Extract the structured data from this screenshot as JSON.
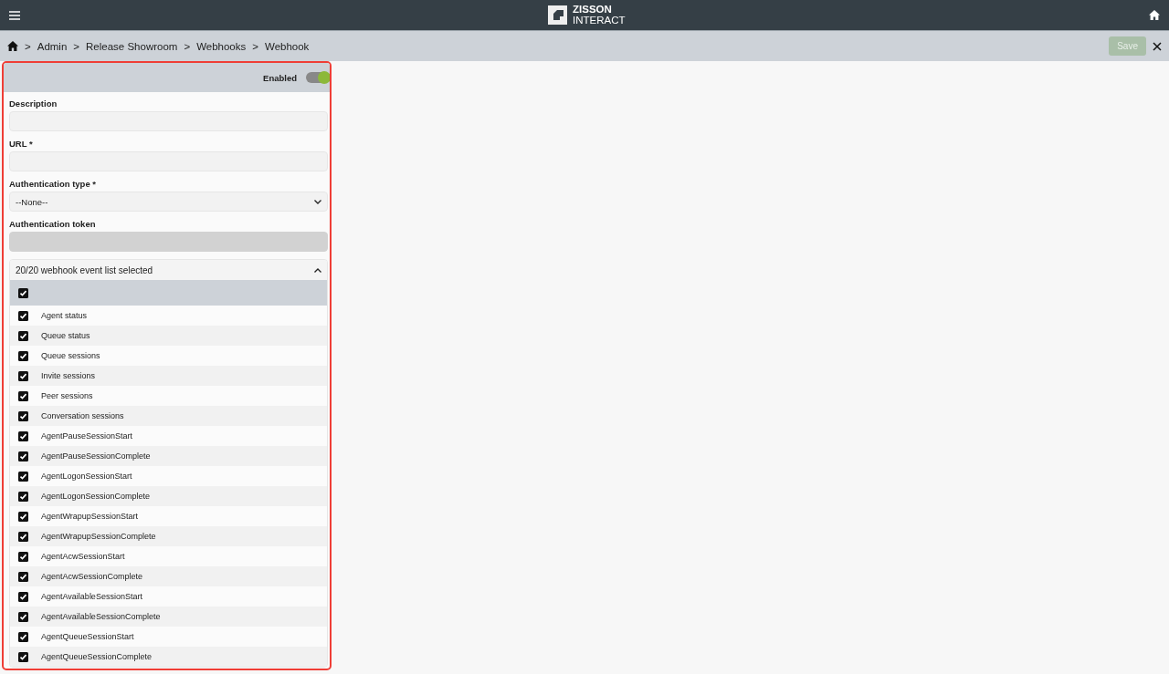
{
  "topbar": {
    "brand_line1": "ZISSON",
    "brand_line2": "INTERACT"
  },
  "breadcrumb": [
    "Admin",
    "Release Showroom",
    "Webhooks",
    "Webhook"
  ],
  "breadcrumb_separator": ">",
  "actions": {
    "save": {
      "label": "Save",
      "disabled": true
    }
  },
  "panel": {
    "enabled_label": "Enabled",
    "enabled": true,
    "fields": [
      {
        "kind": "text",
        "label": "Description",
        "disabled": false
      },
      {
        "kind": "text",
        "label": "URL *",
        "disabled": false
      },
      {
        "kind": "select",
        "label": "Authentication type *",
        "value": "--None--",
        "disabled": false
      },
      {
        "kind": "text",
        "label": "Authentication token",
        "disabled": true
      }
    ],
    "events": {
      "summary": "20/20 webhook event list selected",
      "expanded": true,
      "all_checked": true,
      "items": [
        {
          "label": "Agent status",
          "checked": true
        },
        {
          "label": "Queue status",
          "checked": true
        },
        {
          "label": "Queue sessions",
          "checked": true
        },
        {
          "label": "Invite sessions",
          "checked": true
        },
        {
          "label": "Peer sessions",
          "checked": true
        },
        {
          "label": "Conversation sessions",
          "checked": true
        },
        {
          "label": "AgentPauseSessionStart",
          "checked": true
        },
        {
          "label": "AgentPauseSessionComplete",
          "checked": true
        },
        {
          "label": "AgentLogonSessionStart",
          "checked": true
        },
        {
          "label": "AgentLogonSessionComplete",
          "checked": true
        },
        {
          "label": "AgentWrapupSessionStart",
          "checked": true
        },
        {
          "label": "AgentWrapupSessionComplete",
          "checked": true
        },
        {
          "label": "AgentAcwSessionStart",
          "checked": true
        },
        {
          "label": "AgentAcwSessionComplete",
          "checked": true
        },
        {
          "label": "AgentAvailableSessionStart",
          "checked": true
        },
        {
          "label": "AgentAvailableSessionComplete",
          "checked": true
        },
        {
          "label": "AgentQueueSessionStart",
          "checked": true
        },
        {
          "label": "AgentQueueSessionComplete",
          "checked": true
        }
      ]
    }
  }
}
